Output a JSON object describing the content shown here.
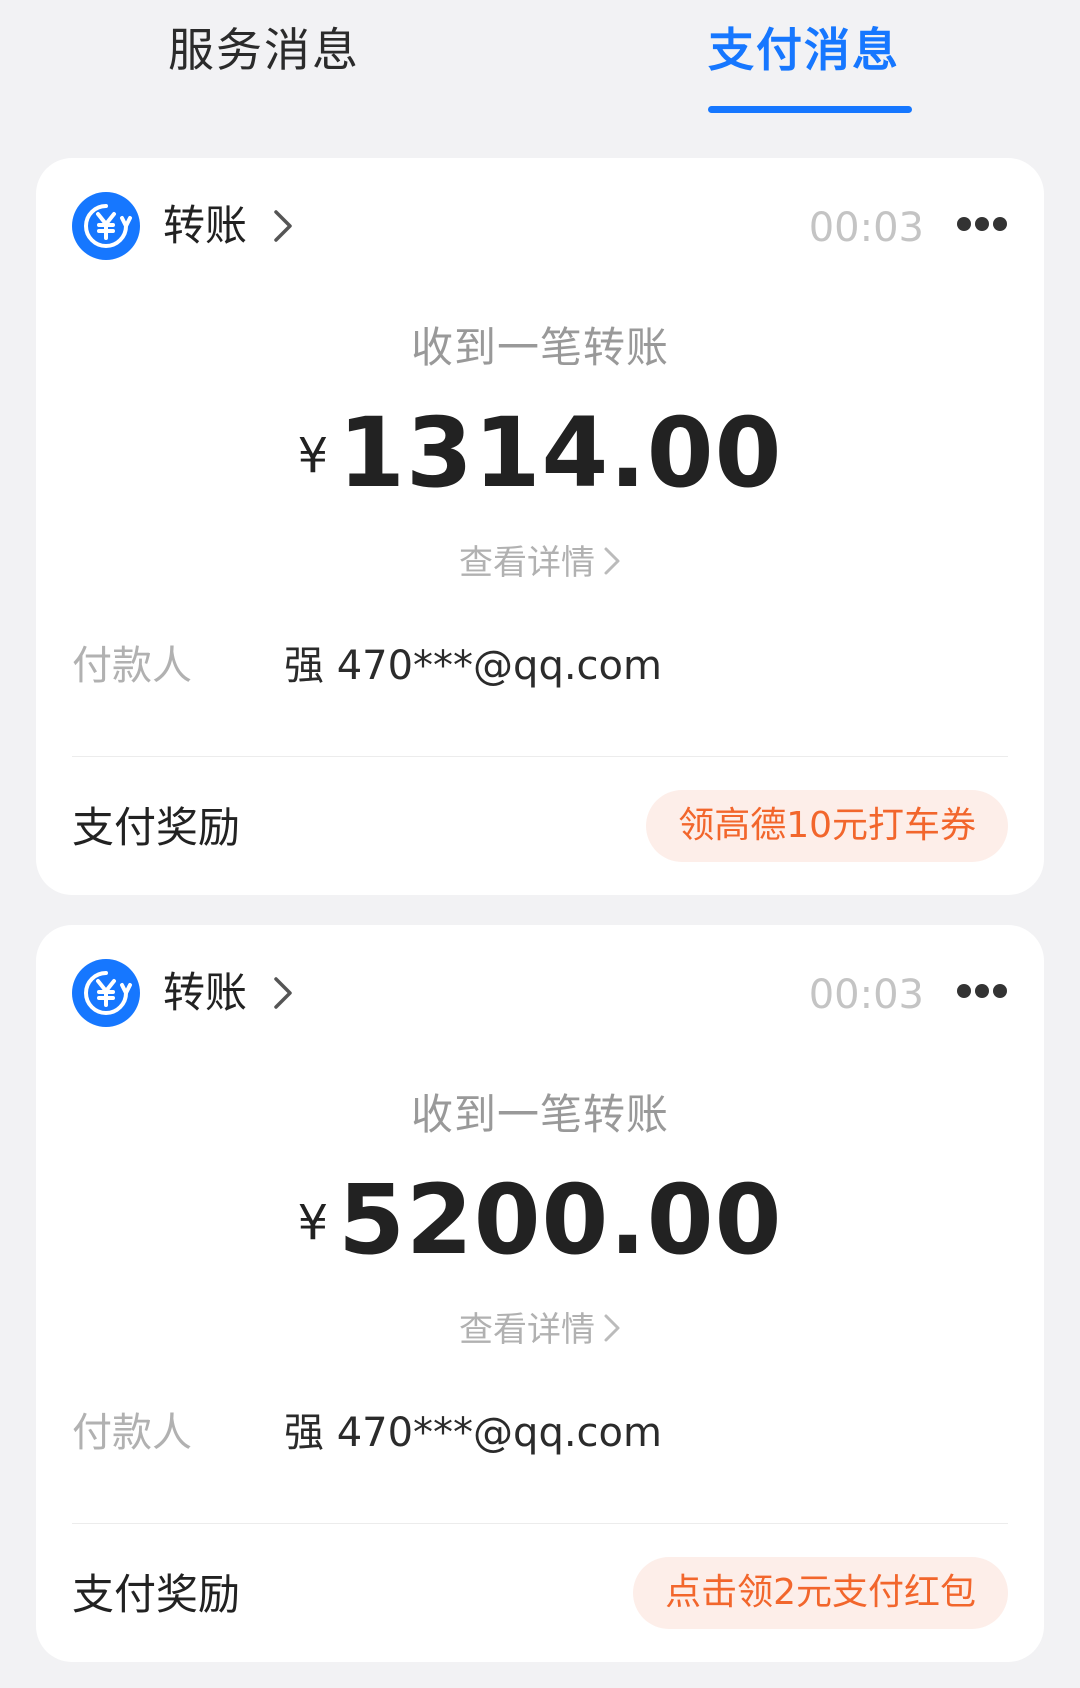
{
  "tabs": {
    "service": "服务消息",
    "payment": "支付消息"
  },
  "colors": {
    "accent": "#1677ff",
    "reward_text": "#f2662c",
    "reward_bg": "#fdeee9"
  },
  "cards": [
    {
      "icon": "transfer-icon",
      "type": "转账",
      "time": "00:03",
      "title": "收到一笔转账",
      "currency": "¥",
      "amount": "1314.00",
      "detail_link": "查看详情",
      "payer_label": "付款人",
      "payer_value": "强 470***@qq.com",
      "reward_label": "支付奖励",
      "reward_action": "领高德10元打车券"
    },
    {
      "icon": "transfer-icon",
      "type": "转账",
      "time": "00:03",
      "title": "收到一笔转账",
      "currency": "¥",
      "amount": "5200.00",
      "detail_link": "查看详情",
      "payer_label": "付款人",
      "payer_value": "强 470***@qq.com",
      "reward_label": "支付奖励",
      "reward_action": "点击领2元支付红包"
    }
  ]
}
